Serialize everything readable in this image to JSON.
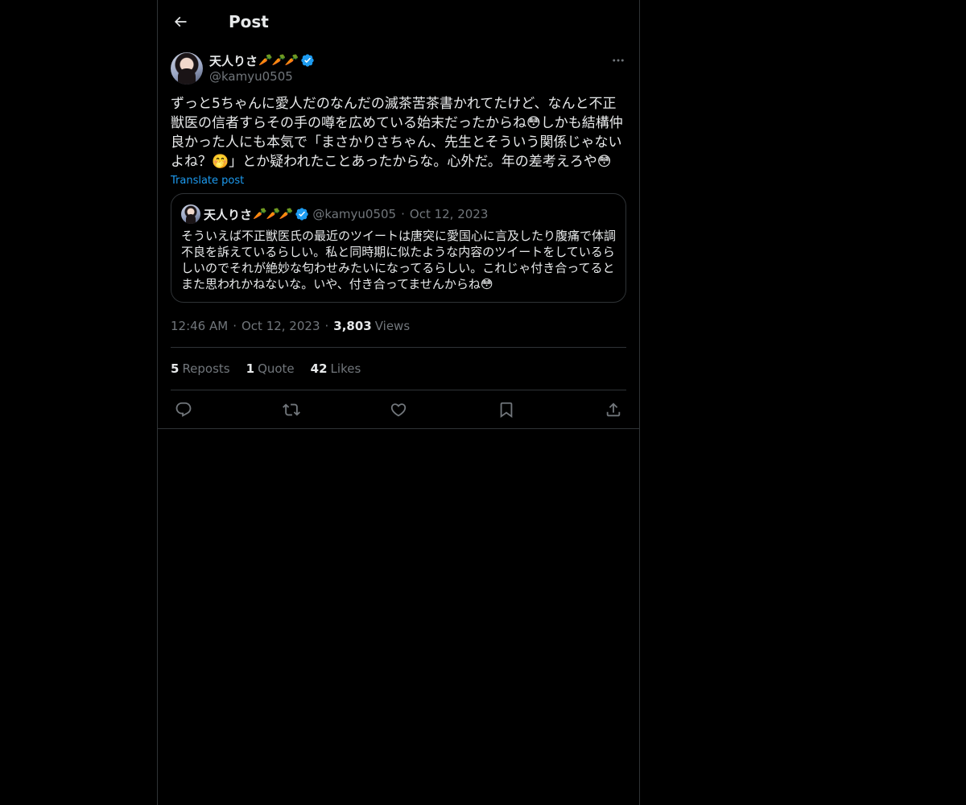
{
  "header": {
    "title": "Post"
  },
  "post": {
    "display_name": "天人りさ",
    "name_emoji": "🥕🥕🥕",
    "handle": "@kamyu0505",
    "text": "ずっと5ちゃんに愛人だのなんだの滅茶苦茶書かれてたけど、なんと不正獣医の信者すらその手の噂を広めている始末だったからね😳しかも結構仲良かった人にも本気で「まさかりさちゃん、先生とそういう関係じゃないよね？🤭」とか疑われたことあったからな。心外だ。年の差考えろや😳",
    "translate_label": "Translate post",
    "time": "12:46 AM",
    "date": "Oct 12, 2023",
    "views_count": "3,803",
    "views_label": "Views"
  },
  "quote": {
    "display_name": "天人りさ",
    "name_emoji": "🥕🥕🥕",
    "handle": "@kamyu0505",
    "date": "Oct 12, 2023",
    "text": "そういえば不正獣医氏の最近のツイートは唐突に愛国心に言及したり腹痛で体調不良を訴えているらしい。私と同時期に似たような内容のツイートをしているらしいのでそれが絶妙な匂わせみたいになってるらしい。これじゃ付き合ってるとまた思われかねないな。いや、付き合ってませんからね😳"
  },
  "stats": {
    "reposts_count": "5",
    "reposts_label": "Reposts",
    "quotes_count": "1",
    "quotes_label": "Quote",
    "likes_count": "42",
    "likes_label": "Likes"
  },
  "icons": {
    "back": "arrow-left-icon",
    "more": "more-horizontal-icon",
    "verified": "verified-badge-icon",
    "reply": "reply-icon",
    "repost": "repost-icon",
    "like": "heart-icon",
    "bookmark": "bookmark-icon",
    "share": "share-icon"
  },
  "colors": {
    "background": "#000000",
    "text": "#e7e9ea",
    "muted": "#71767b",
    "accent": "#1d9bf0",
    "border": "#2f3336"
  }
}
